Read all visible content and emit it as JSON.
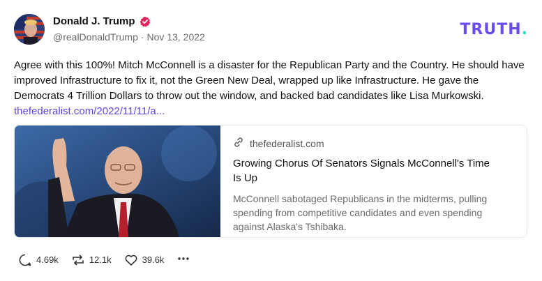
{
  "author": {
    "name": "Donald J. Trump",
    "handle": "@realDonaldTrump",
    "date": "Nov 13, 2022",
    "separator": "·"
  },
  "brand": {
    "name": "TRUTH",
    "dot": "."
  },
  "post": {
    "text": "Agree with this 100%! Mitch McConnell is a disaster for the Republican Party and the Country. He should have improved Infrastructure to fix it, not the Green New Deal, wrapped up like Infrastructure. He gave the Democrats 4 Trillion Dollars to throw out the window, and backed bad candidates like Lisa Murkowski.",
    "link_text": "thefederalist.com/2022/11/11/a..."
  },
  "card": {
    "domain": "thefederalist.com",
    "title": "Growing Chorus Of Senators Signals McConnell's Time Is Up",
    "description": "McConnell sabotaged Republicans in the midterms, pulling spending from competitive candidates and even spending against Alaska's Tshibaka."
  },
  "actions": {
    "replies": "4.69k",
    "retruths": "12.1k",
    "likes": "39.6k"
  },
  "colors": {
    "brand": "#6a4cf0",
    "brand_dot": "#27e0c4",
    "link": "#5b45e6",
    "verified": "#e0245e"
  },
  "icons": [
    "verified-badge-icon",
    "link-icon",
    "reply-icon",
    "retruth-icon",
    "like-icon",
    "more-icon"
  ]
}
